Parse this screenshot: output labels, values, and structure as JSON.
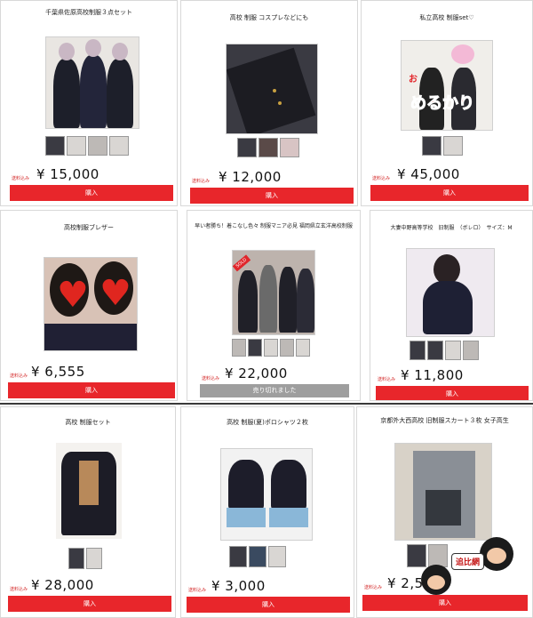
{
  "cards": [
    {
      "title": "千葉県佐原高校制服３点セット",
      "badge": "送料込み",
      "price": "¥ 15,000",
      "button": "購入"
    },
    {
      "title": "高校 制服 コスプレなどにも",
      "badge": "送料込み",
      "price": "¥ 12,000",
      "button": "購入"
    },
    {
      "title": "私立高校 制服set♡",
      "badge": "送料込み",
      "price": "¥ 45,000",
      "button": "購入",
      "overlay": "めるかり",
      "overlay_small": "お"
    },
    {
      "title": "高校制服ブレザー",
      "badge": "送料込み",
      "price": "¥ 6,555",
      "button": "購入"
    },
    {
      "title": "早い者勝ち！着こなし色々 制服マニア必見 福岡県立玄洋高校制服",
      "badge": "送料込み",
      "price": "¥ 22,000",
      "button": "売り切れました",
      "sold_tag": "SOLD"
    },
    {
      "title": "大妻中野高等学校　旧制服　（ボレロ）　サイズ：M",
      "badge": "送料込み",
      "price": "¥ 11,800",
      "button": "購入"
    },
    {
      "title": "高校 制服セット",
      "badge": "送料込み",
      "price": "¥ 28,000",
      "button": "購入"
    },
    {
      "title": "高校 制服(夏)ポロシャツ２枚",
      "badge": "送料込み",
      "price": "¥ 3,000",
      "button": "購入"
    },
    {
      "title": "京都外大西高校 旧制服スカート３枚 女子高生",
      "badge": "送料込み",
      "price": "¥ 2,50",
      "button": "購入"
    }
  ],
  "watermark": "■ 追遊網",
  "logo_text": "追比網",
  "colors": {
    "buy": "#e8262b",
    "sold": "#9e9e9e",
    "badge": "#d21f1f"
  }
}
